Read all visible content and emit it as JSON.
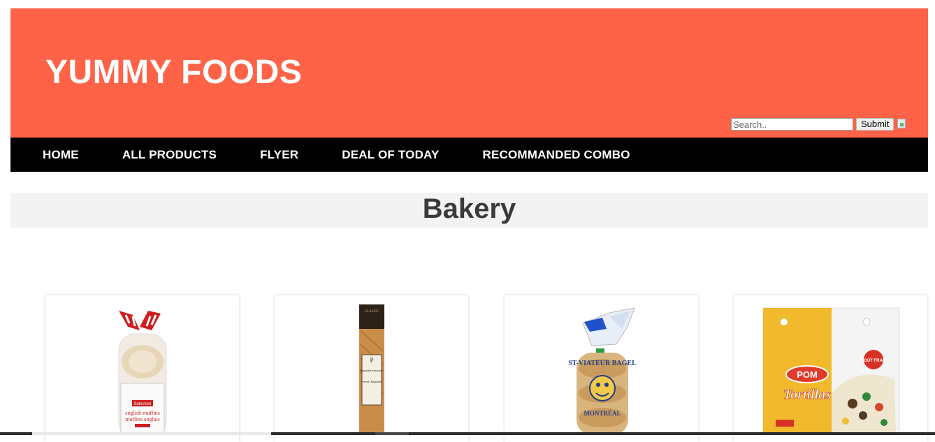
{
  "header": {
    "brand": "YUMMY FOODS",
    "search_placeholder": "Search..",
    "submit_label": "Submit"
  },
  "nav": {
    "items": [
      "HOME",
      "ALL PRODUCTS",
      "FLYER",
      "DEAL OF TODAY",
      "RECOMMANDED COMBO"
    ]
  },
  "section": {
    "title": "Bakery"
  },
  "products": [
    {
      "pkg_label_1": "Selection",
      "pkg_label_2": "english muffins",
      "pkg_label_3": "muffins anglais"
    },
    {
      "pkg_label_1": "CLASSIC",
      "pkg_label_2": "Baguette française",
      "pkg_label_3": "French Baguette"
    },
    {
      "pkg_label_1": "ST-VIATEUR BAGEL",
      "pkg_label_2": "MONTRÉAL"
    },
    {
      "pkg_label_1": "POM",
      "pkg_label_2": "Tortillas",
      "pkg_label_3": "GOÛT FRAIS"
    }
  ],
  "colors": {
    "header_bg": "#ff6347",
    "nav_bg": "#000000",
    "section_bg": "#f3f3f3"
  }
}
